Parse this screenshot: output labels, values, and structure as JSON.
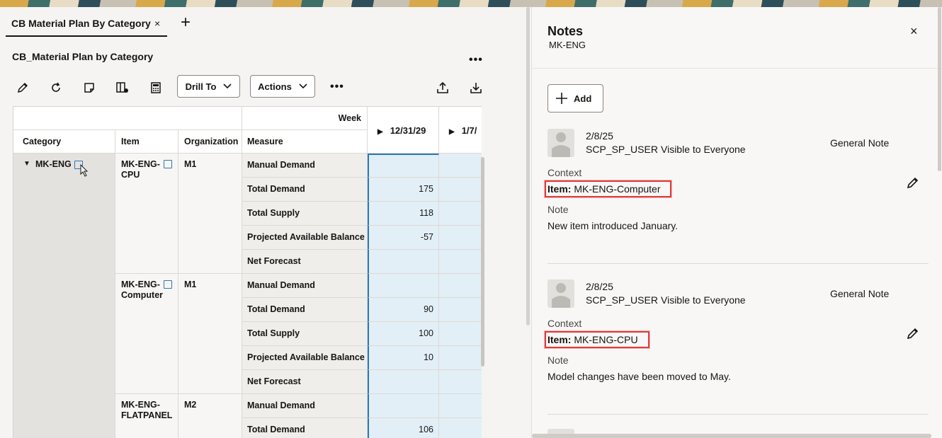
{
  "tab": {
    "label": "CB Material Plan By Category",
    "close": "×",
    "add": "+"
  },
  "page": {
    "title": "CB_Material Plan by Category",
    "more": "•••"
  },
  "toolbar": {
    "icons": [
      "edit-icon",
      "refresh-icon",
      "note-icon",
      "table-settings-icon",
      "calculator-icon"
    ],
    "drill_to": "Drill To",
    "actions": "Actions",
    "more": "•••",
    "export": "export-icon",
    "download": "download-icon"
  },
  "grid": {
    "week_header": "Week",
    "col_headers": {
      "category": "Category",
      "item": "Item",
      "organization": "Organization",
      "measure": "Measure"
    },
    "date_cols": [
      "12/31/29",
      "1/7/"
    ],
    "category": "MK-ENG",
    "groups": [
      {
        "item": "MK-ENG-CPU",
        "item_lines": [
          "MK-ENG-",
          "CPU"
        ],
        "org": "M1",
        "rows": [
          {
            "measure": "Manual Demand",
            "value": ""
          },
          {
            "measure": "Total Demand",
            "value": "175"
          },
          {
            "measure": "Total Supply",
            "value": "118"
          },
          {
            "measure": "Projected Available Balance",
            "value": "-57"
          },
          {
            "measure": "Net Forecast",
            "value": ""
          }
        ]
      },
      {
        "item": "MK-ENG-Computer",
        "item_lines": [
          "MK-ENG-",
          "Computer"
        ],
        "org": "M1",
        "rows": [
          {
            "measure": "Manual Demand",
            "value": ""
          },
          {
            "measure": "Total Demand",
            "value": "90"
          },
          {
            "measure": "Total Supply",
            "value": "100"
          },
          {
            "measure": "Projected Available Balance",
            "value": "10"
          },
          {
            "measure": "Net Forecast",
            "value": ""
          }
        ]
      },
      {
        "item": "MK-ENG-FLATPANEL",
        "item_lines": [
          "MK-ENG-",
          "FLATPANEL"
        ],
        "org": "M2",
        "rows": [
          {
            "measure": "Manual Demand",
            "value": ""
          },
          {
            "measure": "Total Demand",
            "value": "106"
          }
        ]
      }
    ]
  },
  "notes": {
    "title": "Notes",
    "subtitle": "MK-ENG",
    "close": "×",
    "add_label": "Add",
    "items": [
      {
        "date": "2/8/25",
        "user": "SCP_SP_USER",
        "visibility": "Visible to Everyone",
        "type": "General Note",
        "context_label": "Context",
        "context_key": "Item:",
        "context_value": "MK-ENG-Computer",
        "note_label": "Note",
        "text": "New item introduced January."
      },
      {
        "date": "2/8/25",
        "user": "SCP_SP_USER",
        "visibility": "Visible to Everyone",
        "type": "General Note",
        "context_label": "Context",
        "context_key": "Item:",
        "context_value": "MK-ENG-CPU",
        "note_label": "Note",
        "text": "Model changes have been moved to May."
      }
    ]
  }
}
